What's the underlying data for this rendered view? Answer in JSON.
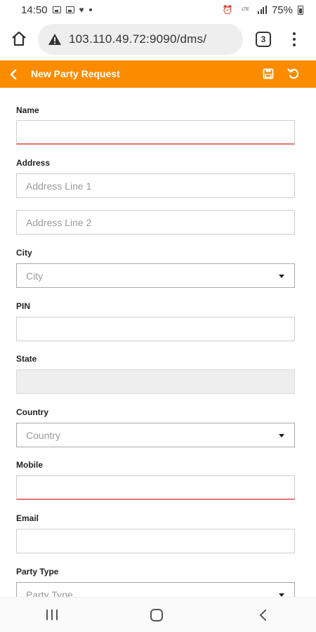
{
  "status_bar": {
    "time": "14:50",
    "battery": "75%",
    "network": "LTE"
  },
  "browser": {
    "url": "103.110.49.72:9090/dms/",
    "tab_count": "3"
  },
  "header": {
    "title": "New Party Request",
    "accent_color": "#fb8c00"
  },
  "form": {
    "name": {
      "label": "Name",
      "value": "",
      "placeholder": ""
    },
    "address": {
      "label": "Address",
      "line1_placeholder": "Address Line 1",
      "line2_placeholder": "Address Line 2"
    },
    "city": {
      "label": "City",
      "placeholder": "City"
    },
    "pin": {
      "label": "PIN",
      "value": ""
    },
    "state": {
      "label": "State",
      "value": ""
    },
    "country": {
      "label": "Country",
      "placeholder": "Country"
    },
    "mobile": {
      "label": "Mobile",
      "value": ""
    },
    "email": {
      "label": "Email",
      "value": ""
    },
    "party_type": {
      "label": "Party Type",
      "placeholder": "Party Type"
    }
  },
  "icons": {
    "home": "home-icon",
    "warning": "warning-icon",
    "tabs": "tabs-icon",
    "menu": "more-vert-icon",
    "back": "chevron-left-icon",
    "save": "save-icon",
    "refresh": "refresh-icon"
  }
}
